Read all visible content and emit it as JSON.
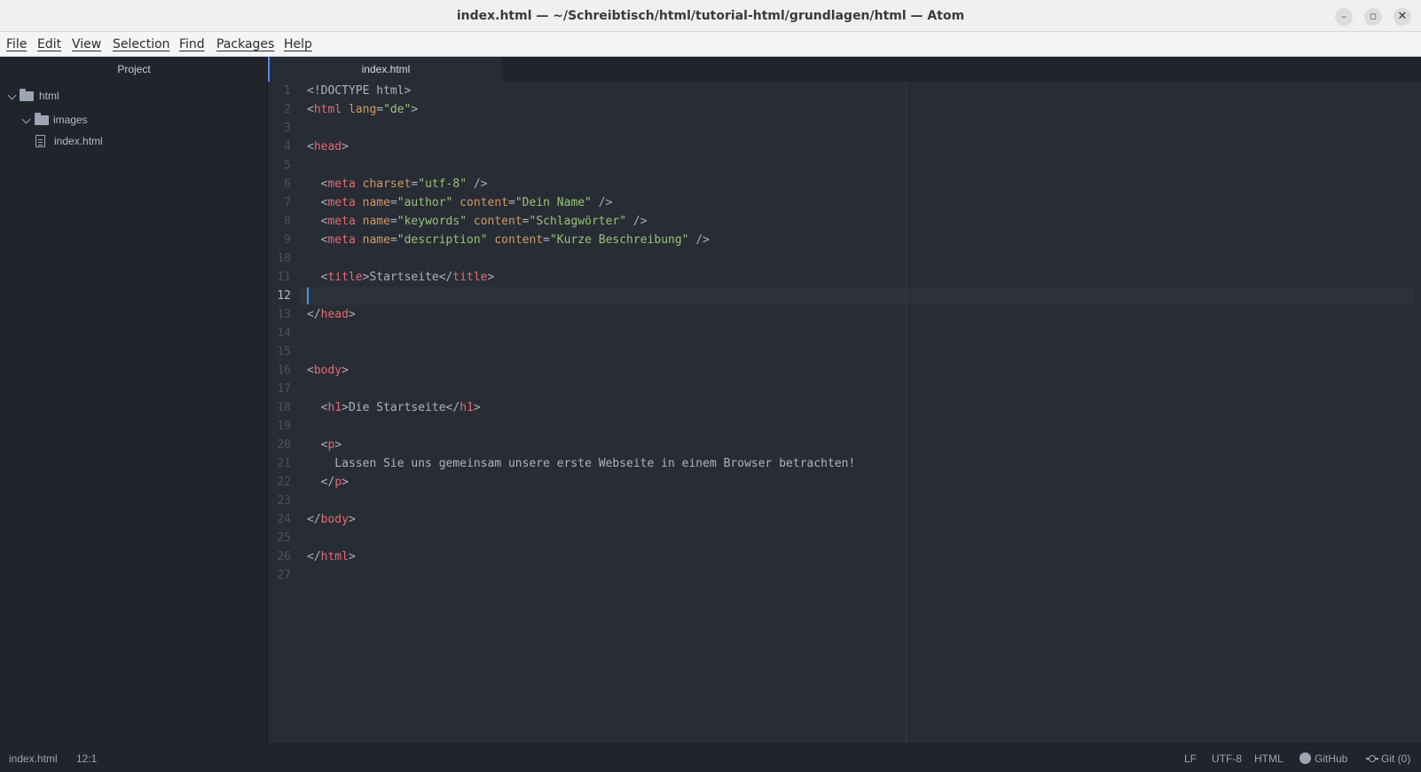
{
  "window": {
    "title": "index.html — ~/Schreibtisch/html/tutorial-html/grundlagen/html — Atom",
    "minimize_glyph": "–",
    "maximize_glyph": "◻",
    "close_glyph": "✕"
  },
  "menu": {
    "items": [
      "File",
      "Edit",
      "View",
      "Selection",
      "Find",
      "Packages",
      "Help"
    ]
  },
  "sidebar": {
    "title": "Project",
    "tree": [
      {
        "label": "html",
        "kind": "folder",
        "expanded": true
      },
      {
        "label": "images",
        "kind": "folder",
        "expanded": true
      },
      {
        "label": "index.html",
        "kind": "file"
      }
    ]
  },
  "tabs": [
    {
      "label": "index.html",
      "active": true
    }
  ],
  "editor": {
    "line_numbers": [
      "1",
      "2",
      "3",
      "4",
      "5",
      "6",
      "7",
      "8",
      "9",
      "10",
      "11",
      "12",
      "13",
      "14",
      "15",
      "16",
      "17",
      "18",
      "19",
      "20",
      "21",
      "22",
      "23",
      "24",
      "25",
      "26",
      "27"
    ],
    "current_line": "12",
    "lines": [
      [
        {
          "t": "<!DOCTYPE html>",
          "c": "pun"
        }
      ],
      [
        {
          "t": "<",
          "c": "pun"
        },
        {
          "t": "html",
          "c": "tag"
        },
        {
          "t": " ",
          "c": "pun"
        },
        {
          "t": "lang",
          "c": "attr"
        },
        {
          "t": "=",
          "c": "pun"
        },
        {
          "t": "\"de\"",
          "c": "str"
        },
        {
          "t": ">",
          "c": "pun"
        }
      ],
      [],
      [
        {
          "t": "<",
          "c": "pun"
        },
        {
          "t": "head",
          "c": "tag"
        },
        {
          "t": ">",
          "c": "pun"
        }
      ],
      [],
      [
        {
          "t": "  <",
          "c": "pun"
        },
        {
          "t": "meta",
          "c": "tag"
        },
        {
          "t": " ",
          "c": "pun"
        },
        {
          "t": "charset",
          "c": "attr"
        },
        {
          "t": "=",
          "c": "pun"
        },
        {
          "t": "\"utf-8\"",
          "c": "str"
        },
        {
          "t": " />",
          "c": "pun"
        }
      ],
      [
        {
          "t": "  <",
          "c": "pun"
        },
        {
          "t": "meta",
          "c": "tag"
        },
        {
          "t": " ",
          "c": "pun"
        },
        {
          "t": "name",
          "c": "attr"
        },
        {
          "t": "=",
          "c": "pun"
        },
        {
          "t": "\"author\"",
          "c": "str"
        },
        {
          "t": " ",
          "c": "pun"
        },
        {
          "t": "content",
          "c": "attr"
        },
        {
          "t": "=",
          "c": "pun"
        },
        {
          "t": "\"Dein Name\"",
          "c": "str"
        },
        {
          "t": " />",
          "c": "pun"
        }
      ],
      [
        {
          "t": "  <",
          "c": "pun"
        },
        {
          "t": "meta",
          "c": "tag"
        },
        {
          "t": " ",
          "c": "pun"
        },
        {
          "t": "name",
          "c": "attr"
        },
        {
          "t": "=",
          "c": "pun"
        },
        {
          "t": "\"keywords\"",
          "c": "str"
        },
        {
          "t": " ",
          "c": "pun"
        },
        {
          "t": "content",
          "c": "attr"
        },
        {
          "t": "=",
          "c": "pun"
        },
        {
          "t": "\"Schlagwörter\"",
          "c": "str"
        },
        {
          "t": " />",
          "c": "pun"
        }
      ],
      [
        {
          "t": "  <",
          "c": "pun"
        },
        {
          "t": "meta",
          "c": "tag"
        },
        {
          "t": " ",
          "c": "pun"
        },
        {
          "t": "name",
          "c": "attr"
        },
        {
          "t": "=",
          "c": "pun"
        },
        {
          "t": "\"description\"",
          "c": "str"
        },
        {
          "t": " ",
          "c": "pun"
        },
        {
          "t": "content",
          "c": "attr"
        },
        {
          "t": "=",
          "c": "pun"
        },
        {
          "t": "\"Kurze Beschreibung\"",
          "c": "str"
        },
        {
          "t": " />",
          "c": "pun"
        }
      ],
      [],
      [
        {
          "t": "  <",
          "c": "pun"
        },
        {
          "t": "title",
          "c": "tag"
        },
        {
          "t": ">Startseite</",
          "c": "pun"
        },
        {
          "t": "title",
          "c": "tag"
        },
        {
          "t": ">",
          "c": "pun"
        }
      ],
      [],
      [
        {
          "t": "</",
          "c": "pun"
        },
        {
          "t": "head",
          "c": "tag"
        },
        {
          "t": ">",
          "c": "pun"
        }
      ],
      [],
      [],
      [
        {
          "t": "<",
          "c": "pun"
        },
        {
          "t": "body",
          "c": "tag"
        },
        {
          "t": ">",
          "c": "pun"
        }
      ],
      [],
      [
        {
          "t": "  <",
          "c": "pun"
        },
        {
          "t": "h1",
          "c": "tag"
        },
        {
          "t": ">Die Startseite</",
          "c": "pun"
        },
        {
          "t": "h1",
          "c": "tag"
        },
        {
          "t": ">",
          "c": "pun"
        }
      ],
      [],
      [
        {
          "t": "  <",
          "c": "pun"
        },
        {
          "t": "p",
          "c": "tag"
        },
        {
          "t": ">",
          "c": "pun"
        }
      ],
      [
        {
          "t": "    Lassen Sie uns gemeinsam unsere erste Webseite in einem Browser betrachten!",
          "c": "pun"
        }
      ],
      [
        {
          "t": "  </",
          "c": "pun"
        },
        {
          "t": "p",
          "c": "tag"
        },
        {
          "t": ">",
          "c": "pun"
        }
      ],
      [],
      [
        {
          "t": "</",
          "c": "pun"
        },
        {
          "t": "body",
          "c": "tag"
        },
        {
          "t": ">",
          "c": "pun"
        }
      ],
      [],
      [
        {
          "t": "</",
          "c": "pun"
        },
        {
          "t": "html",
          "c": "tag"
        },
        {
          "t": ">",
          "c": "pun"
        }
      ],
      []
    ]
  },
  "statusbar": {
    "file": "index.html",
    "cursor_pos": "12:1",
    "line_ending": "LF",
    "encoding": "UTF-8",
    "grammar": "HTML",
    "github": "GitHub",
    "git": "Git (0)"
  },
  "colors": {
    "tag": "#e06c75",
    "attribute": "#d19a66",
    "string": "#98c379",
    "text": "#abb2bf",
    "cursor": "#528bff",
    "background": "#282c34",
    "panel": "#21252b"
  }
}
